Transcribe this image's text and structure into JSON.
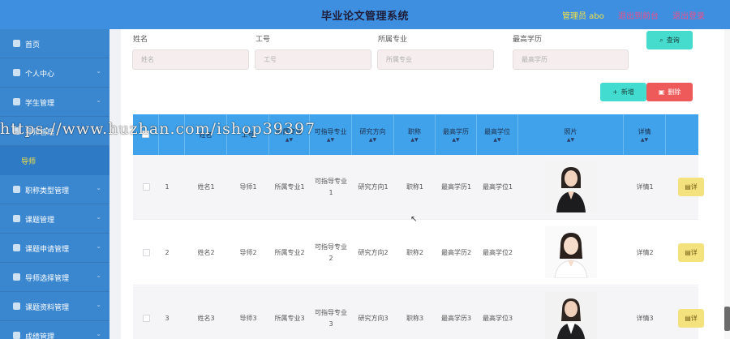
{
  "header": {
    "title": "毕业论文管理系统",
    "admin_label": "管理员 abo",
    "exit_front": "退出到前台",
    "logout": "退出登录"
  },
  "sidebar": {
    "items": [
      {
        "label": "首页",
        "icon": "home-icon"
      },
      {
        "label": "个人中心",
        "icon": "user-icon"
      },
      {
        "label": "学生管理",
        "icon": "student-icon"
      },
      {
        "label": "导师管理",
        "icon": "teacher-icon"
      },
      {
        "label": "职称类型管理",
        "icon": "send-icon"
      },
      {
        "label": "课题管理",
        "icon": "topic-icon"
      },
      {
        "label": "课题申请管理",
        "icon": "apply-icon"
      },
      {
        "label": "导师选择管理",
        "icon": "select-icon"
      },
      {
        "label": "课题资料管理",
        "icon": "doc-icon"
      },
      {
        "label": "成绩管理",
        "icon": "score-icon"
      }
    ],
    "active_submenu": "导师"
  },
  "search": {
    "fields": [
      {
        "label": "姓名",
        "placeholder": "姓名"
      },
      {
        "label": "工号",
        "placeholder": "工号"
      },
      {
        "label": "所属专业",
        "placeholder": "所属专业"
      },
      {
        "label": "最高学历",
        "placeholder": "最高学历"
      }
    ],
    "query_button": "查询"
  },
  "toolbar": {
    "add_button": "新增",
    "delete_button": "删除"
  },
  "table": {
    "columns": [
      "",
      "",
      "姓名",
      "工号",
      "所属专业",
      "可指导专业",
      "研究方向",
      "职称",
      "最高学历",
      "最高学位",
      "照片",
      "详情",
      ""
    ],
    "rows": [
      {
        "index": "1",
        "name": "姓名1",
        "id": "导师1",
        "major": "所属专业1",
        "guide_major": "可指导专业1",
        "research": "研究方向1",
        "title": "职称1",
        "edu": "最高学历1",
        "degree": "最高学位1",
        "detail": "详情1"
      },
      {
        "index": "2",
        "name": "姓名2",
        "id": "导师2",
        "major": "所属专业2",
        "guide_major": "可指导专业2",
        "research": "研究方向2",
        "title": "职称2",
        "edu": "最高学历2",
        "degree": "最高学位2",
        "detail": "详情2"
      },
      {
        "index": "3",
        "name": "姓名3",
        "id": "导师3",
        "major": "所属专业3",
        "guide_major": "可指导专业3",
        "research": "研究方向3",
        "title": "职称3",
        "edu": "最高学历3",
        "degree": "最高学位3",
        "detail": "详情3"
      }
    ],
    "detail_button": "详"
  },
  "watermark": "https://www.huzhan.com/ishop39397",
  "colors": {
    "header_bg": "#3f8fe0",
    "sidebar_bg": "#3a87d0",
    "table_header_bg": "#3fa2ea",
    "accent_cyan": "#46dccd",
    "danger": "#ee5a5a",
    "warning": "#f4e27e",
    "admin_text": "#f0e048",
    "link_pink": "#e8508c"
  }
}
